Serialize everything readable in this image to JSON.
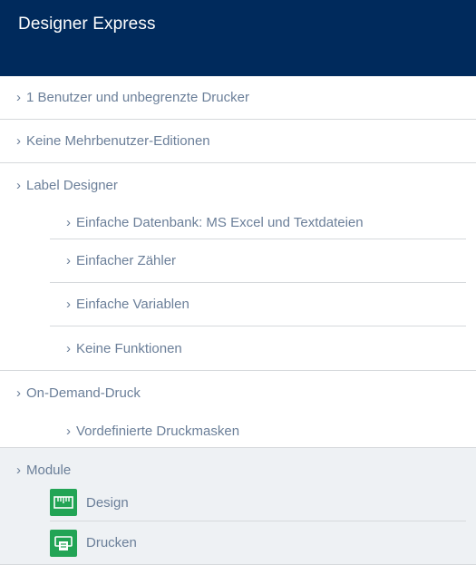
{
  "header": {
    "title": "Designer Express"
  },
  "chevron": "›",
  "items": [
    {
      "label": "1 Benutzer und unbegrenzte Drucker"
    },
    {
      "label": "Keine Mehrbenutzer-Editionen"
    }
  ],
  "label_designer": {
    "label": "Label Designer",
    "features": [
      "Einfache Datenbank: MS Excel und Textdateien",
      "Einfacher Zähler",
      "Einfache Variablen",
      "Keine Funktionen"
    ]
  },
  "on_demand": {
    "label": "On-Demand-Druck",
    "features": [
      "Vordefinierte Druckmasken"
    ]
  },
  "modules": {
    "label": "Module",
    "items": [
      {
        "label": "Design",
        "icon": "design-module-icon"
      },
      {
        "label": "Drucken",
        "icon": "print-module-icon"
      }
    ]
  },
  "colors": {
    "header_bg": "#002a5c",
    "text": "#6b7f99",
    "module_bg": "#eef1f4",
    "icon_green": "#22a455",
    "divider": "#d6d9dc"
  }
}
